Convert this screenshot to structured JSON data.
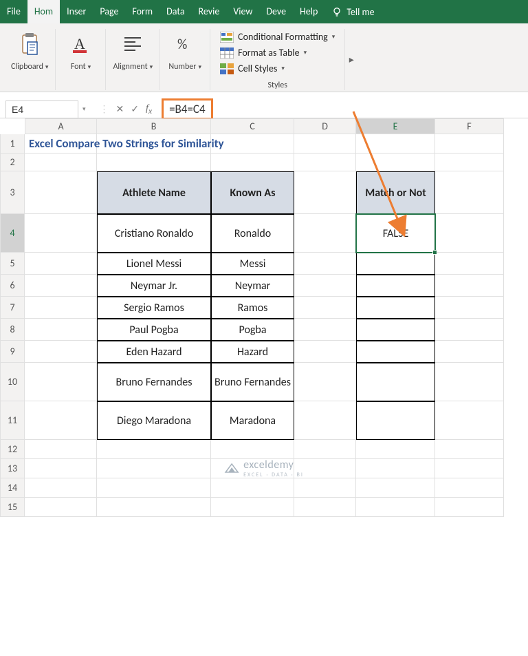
{
  "ribbon": {
    "tabs": [
      "File",
      "Hom",
      "Inser",
      "Page",
      "Form",
      "Data",
      "Revie",
      "View",
      "Deve",
      "Help"
    ],
    "active_tab": 1,
    "tellme": "Tell me",
    "groups": {
      "clipboard": "Clipboard",
      "font": "Font",
      "alignment": "Alignment",
      "number": "Number"
    },
    "styles": {
      "cond_fmt": "Conditional Formatting",
      "fmt_table": "Format as Table",
      "cell_styles": "Cell Styles",
      "label": "Styles"
    }
  },
  "formula_bar": {
    "namebox": "E4",
    "formula": "=B4=C4"
  },
  "columns": [
    "A",
    "B",
    "C",
    "D",
    "E",
    "F"
  ],
  "rows": [
    "1",
    "2",
    "3",
    "4",
    "5",
    "6",
    "7",
    "8",
    "9",
    "10",
    "11",
    "12",
    "13",
    "14",
    "15"
  ],
  "sheet": {
    "title": "Excel Compare Two Strings for Similarity",
    "headers": {
      "b": "Athlete Name",
      "c": "Known As",
      "e": "Match or Not"
    },
    "data": [
      {
        "b": "Cristiano Ronaldo",
        "c": "Ronaldo",
        "e": "FALSE"
      },
      {
        "b": "Lionel Messi",
        "c": "Messi",
        "e": ""
      },
      {
        "b": "Neymar Jr.",
        "c": "Neymar",
        "e": ""
      },
      {
        "b": "Sergio Ramos",
        "c": "Ramos",
        "e": ""
      },
      {
        "b": "Paul Pogba",
        "c": "Pogba",
        "e": ""
      },
      {
        "b": "Eden Hazard",
        "c": "Hazard",
        "e": ""
      },
      {
        "b": "Bruno Fernandes",
        "c": "Bruno Fernandes",
        "e": ""
      },
      {
        "b": "Diego Maradona",
        "c": "Maradona",
        "e": ""
      }
    ],
    "selected": "E4"
  },
  "watermark": {
    "name": "exceldemy",
    "tag": "EXCEL · DATA · BI"
  },
  "colors": {
    "accent": "#217346",
    "highlight": "#ed7d31",
    "header_fill": "#d6dce5",
    "title": "#2f5597"
  }
}
